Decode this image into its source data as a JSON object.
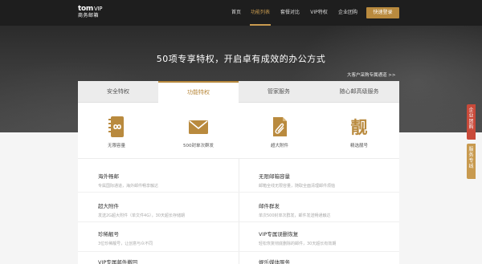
{
  "header": {
    "logo_line1": "tom",
    "logo_vip": "VIP",
    "logo_line2": "商务邮箱",
    "nav": [
      "首页",
      "功能列表",
      "套餐对比",
      "VIP特权",
      "企业团购"
    ],
    "active_nav": "功能列表",
    "cta_label": "快速登录"
  },
  "hero": {
    "title": "50项专享特权，开启卓有成效的办公方式",
    "enterprise_link": "大客户采购专属通道 >>"
  },
  "tabs": [
    "安全特权",
    "功能特权",
    "管家服务",
    "随心邮高级服务"
  ],
  "active_tab": "功能特权",
  "features": [
    {
      "icon": "infinity-icon",
      "label": "无限容量"
    },
    {
      "icon": "envelope-icon",
      "label": "500封单次群发"
    },
    {
      "icon": "paperclip-icon",
      "label": "超大附件"
    },
    {
      "icon": "pretty-char-icon",
      "label": "精选靓号"
    }
  ],
  "feature_icon_text": "靓",
  "items": [
    {
      "title": "海外畅邮",
      "desc": "专属国际通道，海外邮件畅享触达"
    },
    {
      "title": "无限邮箱容量",
      "desc": "邮箱全线无限容量，随取全面清理邮件烦恼"
    },
    {
      "title": "超大附件",
      "desc": "发送2G超大附件（单文件4G），30天超长存储期"
    },
    {
      "title": "邮件群发",
      "desc": "单次500封单次群发，邮件发送畅通触达"
    },
    {
      "title": "珍稀靓号",
      "desc": "3位珍稀靓号，让创意与众不同"
    },
    {
      "title": "VIP专属误删恢复",
      "desc": "轻松恢复彻底删除的邮件，30天超长有效期"
    },
    {
      "title": "VIP专属邮件撤回",
      "desc": ""
    },
    {
      "title": "娱乐媒体服务",
      "desc": ""
    }
  ],
  "side_buttons": [
    "企业团购",
    "服务专线"
  ],
  "colors": {
    "accent": "#b98a3e",
    "dark": "#1e1e1e",
    "side_red": "#c94a3a"
  }
}
